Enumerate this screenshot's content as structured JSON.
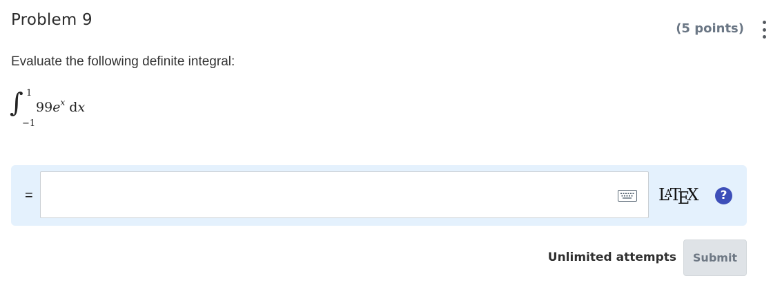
{
  "problem": {
    "title": "Problem 9",
    "points": "(5 points)",
    "menu_icon": "kebab-menu-icon",
    "prompt": "Evaluate the following definite integral:"
  },
  "integral": {
    "sign": "∫",
    "upper_limit": "1",
    "lower_limit": "−1",
    "coefficient": "99",
    "base": "e",
    "exponent": "x",
    "differential": "d",
    "variable": "x"
  },
  "answer": {
    "equals": "=",
    "value": "",
    "placeholder": "",
    "keyboard_icon": "keyboard-icon",
    "latex_L": "L",
    "latex_A": "A",
    "latex_T": "T",
    "latex_E": "E",
    "latex_X": "X",
    "help_label": "?",
    "panel_color": "#e4f1fd",
    "help_color": "#3d4fb9"
  },
  "footer": {
    "attempts": "Unlimited attempts",
    "submit_label": "Submit"
  }
}
